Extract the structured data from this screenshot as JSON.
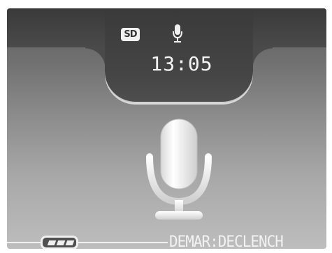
{
  "status": {
    "storage_badge": "SD",
    "time": "13:05"
  },
  "icons": {
    "storage": "sd-card-icon",
    "recording": "microphone-icon",
    "main": "microphone-icon",
    "battery": "battery-icon"
  },
  "footer": {
    "hint": "DEMAR:DECLENCH"
  },
  "battery": {
    "level_fraction": 1.0
  },
  "colors": {
    "text": "#f2f2f2",
    "tab": "#3a3a3a"
  }
}
